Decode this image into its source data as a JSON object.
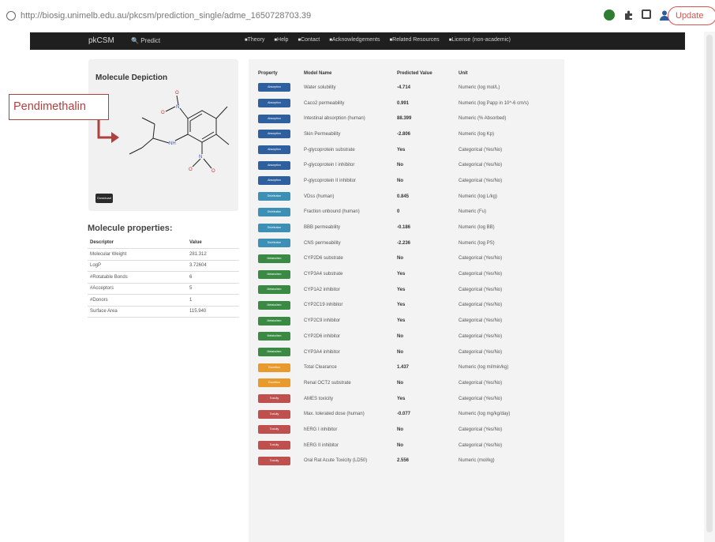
{
  "browser": {
    "url": "http://biosig.unimelb.edu.au/pkcsm/prediction_single/adme_1650728703.39",
    "update_label": "Update"
  },
  "navbar": {
    "brand": "pkCSM",
    "predict": "Predict",
    "items": [
      "Theory",
      "Help",
      "Contact",
      "Acknowledgements",
      "Related Resources",
      "License (non-academic)"
    ]
  },
  "depiction": {
    "title": "Molecule Depiction",
    "download_label": "Download"
  },
  "callout": {
    "label": "Pendimethalin",
    "color": "#b04040"
  },
  "properties": {
    "title": "Molecule properties:",
    "headers": [
      "Descriptor",
      "Value"
    ],
    "rows": [
      [
        "Molecular Weight",
        "281.312"
      ],
      [
        "LogP",
        "3.72604"
      ],
      [
        "#Rotatable Bonds",
        "6"
      ],
      [
        "#Acceptors",
        "5"
      ],
      [
        "#Donors",
        "1"
      ],
      [
        "Surface Area",
        "115.940"
      ]
    ]
  },
  "predictions": {
    "headers": [
      "Property",
      "Model Name",
      "Predicted Value",
      "Unit"
    ],
    "rows": [
      {
        "category": "absorption",
        "badge": "Absorption",
        "model": "Water solubility",
        "value": "-4.714",
        "unit": "Numeric (log mol/L)"
      },
      {
        "category": "absorption",
        "badge": "Absorption",
        "model": "Caco2 permeability",
        "value": "0.991",
        "unit": "Numeric (log Papp in 10^-6 cm/s)"
      },
      {
        "category": "absorption",
        "badge": "Absorption",
        "model": "Intestinal absorption (human)",
        "value": "88.399",
        "unit": "Numeric (% Absorbed)"
      },
      {
        "category": "absorption",
        "badge": "Absorption",
        "model": "Skin Permeability",
        "value": "-2.806",
        "unit": "Numeric (log Kp)"
      },
      {
        "category": "absorption",
        "badge": "Absorption",
        "model": "P-glycoprotein substrate",
        "value": "Yes",
        "unit": "Categorical (Yes/No)"
      },
      {
        "category": "absorption",
        "badge": "Absorption",
        "model": "P-glycoprotein I inhibitor",
        "value": "No",
        "unit": "Categorical (Yes/No)"
      },
      {
        "category": "absorption",
        "badge": "Absorption",
        "model": "P-glycoprotein II inhibitor",
        "value": "No",
        "unit": "Categorical (Yes/No)"
      },
      {
        "category": "distribution",
        "badge": "Distribution",
        "model": "VDss (human)",
        "value": "0.845",
        "unit": "Numeric (log L/kg)"
      },
      {
        "category": "distribution",
        "badge": "Distribution",
        "model": "Fraction unbound (human)",
        "value": "0",
        "unit": "Numeric (Fu)"
      },
      {
        "category": "distribution",
        "badge": "Distribution",
        "model": "BBB permeability",
        "value": "-0.186",
        "unit": "Numeric (log BB)"
      },
      {
        "category": "distribution",
        "badge": "Distribution",
        "model": "CNS permeability",
        "value": "-2.236",
        "unit": "Numeric (log PS)"
      },
      {
        "category": "metabolism",
        "badge": "Metabolism",
        "model": "CYP2D6 substrate",
        "value": "No",
        "unit": "Categorical (Yes/No)"
      },
      {
        "category": "metabolism",
        "badge": "Metabolism",
        "model": "CYP3A4 substrate",
        "value": "Yes",
        "unit": "Categorical (Yes/No)"
      },
      {
        "category": "metabolism",
        "badge": "Metabolism",
        "model": "CYP1A2 inhibitor",
        "value": "Yes",
        "unit": "Categorical (Yes/No)"
      },
      {
        "category": "metabolism",
        "badge": "Metabolism",
        "model": "CYP2C19 inhibitor",
        "value": "Yes",
        "unit": "Categorical (Yes/No)"
      },
      {
        "category": "metabolism",
        "badge": "Metabolism",
        "model": "CYP2C9 inhibitor",
        "value": "Yes",
        "unit": "Categorical (Yes/No)"
      },
      {
        "category": "metabolism",
        "badge": "Metabolism",
        "model": "CYP2D6 inhibitor",
        "value": "No",
        "unit": "Categorical (Yes/No)"
      },
      {
        "category": "metabolism",
        "badge": "Metabolism",
        "model": "CYP3A4 inhibitor",
        "value": "No",
        "unit": "Categorical (Yes/No)"
      },
      {
        "category": "excretion",
        "badge": "Excretion",
        "model": "Total Clearance",
        "value": "1.437",
        "unit": "Numeric (log ml/min/kg)"
      },
      {
        "category": "excretion",
        "badge": "Excretion",
        "model": "Renal OCT2 substrate",
        "value": "No",
        "unit": "Categorical (Yes/No)"
      },
      {
        "category": "toxicity",
        "badge": "Toxicity",
        "model": "AMES toxicity",
        "value": "Yes",
        "unit": "Categorical (Yes/No)"
      },
      {
        "category": "toxicity",
        "badge": "Toxicity",
        "model": "Max. tolerated dose (human)",
        "value": "-0.077",
        "unit": "Numeric (log mg/kg/day)"
      },
      {
        "category": "toxicity",
        "badge": "Toxicity",
        "model": "hERG I inhibitor",
        "value": "No",
        "unit": "Categorical (Yes/No)"
      },
      {
        "category": "toxicity",
        "badge": "Toxicity",
        "model": "hERG II inhibitor",
        "value": "No",
        "unit": "Categorical (Yes/No)"
      },
      {
        "category": "toxicity",
        "badge": "Toxicity",
        "model": "Oral Rat Acute Toxicity (LD50)",
        "value": "2.556",
        "unit": "Numeric (mol/kg)"
      }
    ]
  }
}
